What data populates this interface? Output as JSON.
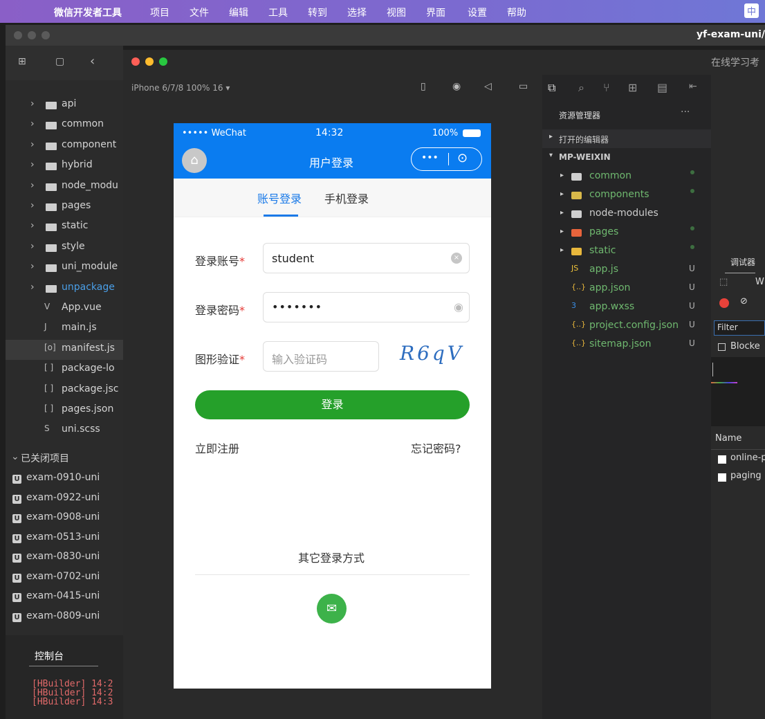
{
  "menubar": {
    "app_name": "微信开发者工具",
    "items": [
      "项目",
      "文件",
      "编辑",
      "工具",
      "转到",
      "选择",
      "视图",
      "界面",
      "设置",
      "帮助"
    ],
    "input_method": "中"
  },
  "hbuilder": {
    "window_title": "yf-exam-uni/",
    "tree": [
      {
        "label": "api",
        "type": "folder"
      },
      {
        "label": "common",
        "type": "folder"
      },
      {
        "label": "component",
        "type": "folder"
      },
      {
        "label": "hybrid",
        "type": "folder"
      },
      {
        "label": "node_modu",
        "type": "folder"
      },
      {
        "label": "pages",
        "type": "folder"
      },
      {
        "label": "static",
        "type": "folder"
      },
      {
        "label": "style",
        "type": "folder"
      },
      {
        "label": "uni_module",
        "type": "folder"
      },
      {
        "label": "unpackage",
        "type": "folder"
      },
      {
        "label": "App.vue",
        "type": "file"
      },
      {
        "label": "main.js",
        "type": "file"
      },
      {
        "label": "manifest.js",
        "type": "file"
      },
      {
        "label": "package-lo",
        "type": "file"
      },
      {
        "label": "package.jsc",
        "type": "file"
      },
      {
        "label": "pages.json",
        "type": "file"
      },
      {
        "label": "uni.scss",
        "type": "file"
      }
    ],
    "file_icons": [
      "V",
      "J",
      "[o]",
      "[ ]",
      "[ ]",
      "[ ]",
      "S"
    ],
    "closed_header": "已关闭项目",
    "closed_projects": [
      "exam-0910-uni",
      "exam-0922-uni",
      "exam-0908-uni",
      "exam-0513-uni",
      "exam-0830-uni",
      "exam-0702-uni",
      "exam-0415-uni",
      "exam-0809-uni"
    ],
    "console_title": "控制台",
    "console_lines": [
      "[HBuilder] 14:2",
      "[HBuilder] 14:2",
      "[HBuilder] 14:3"
    ]
  },
  "devtools": {
    "right_title": "在线学习考",
    "device": "iPhone 6/7/8 100% 16 ▾",
    "explorer_title": "资源管理器",
    "explorer_more": "···",
    "open_editors": "打开的编辑器",
    "root": "MP-WEIXIN",
    "files": [
      {
        "name": "common",
        "badge": "",
        "dot": true
      },
      {
        "name": "components",
        "badge": "",
        "dot": true
      },
      {
        "name": "node-modules",
        "badge": "",
        "dot": false
      },
      {
        "name": "pages",
        "badge": "",
        "dot": true
      },
      {
        "name": "static",
        "badge": "",
        "dot": true
      },
      {
        "name": "app.js",
        "badge": "U",
        "dot": false
      },
      {
        "name": "app.json",
        "badge": "U",
        "dot": false
      },
      {
        "name": "app.wxss",
        "badge": "U",
        "dot": false
      },
      {
        "name": "project.config.json",
        "badge": "U",
        "dot": false
      },
      {
        "name": "sitemap.json",
        "badge": "U",
        "dot": false
      }
    ],
    "file_icon_labels": [
      "JS",
      "{..}",
      "3",
      "{..}",
      "{..}"
    ],
    "debug_tab": "调试器",
    "debug_w": "W",
    "filter": "Filter",
    "blocked": "Blocke",
    "name_col": "Name",
    "requests": [
      "online-p",
      "paging"
    ]
  },
  "phone": {
    "status_carrier": "••••• WeChat",
    "status_time": "14:32",
    "status_battery": "100%",
    "nav_title": "用户登录",
    "capsule_dots": "•••",
    "tabs": [
      "账号登录",
      "手机登录"
    ],
    "account_label": "登录账号",
    "account_value": "student",
    "password_label": "登录密码",
    "password_value": "•••••••",
    "captcha_label": "图形验证",
    "captcha_placeholder": "输入验证码",
    "captcha_text": "R6qV",
    "asterisk": "*",
    "login_button": "登录",
    "register": "立即注册",
    "forgot": "忘记密码?",
    "other_login": "其它登录方式"
  }
}
